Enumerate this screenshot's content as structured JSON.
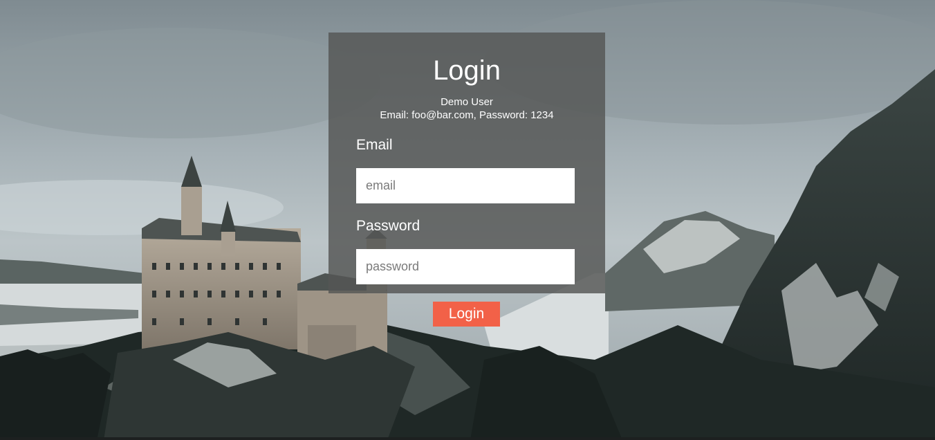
{
  "login": {
    "title": "Login",
    "demo_heading": "Demo User",
    "demo_credentials": "Email: foo@bar.com, Password: 1234",
    "email_label": "Email",
    "email_placeholder": "email",
    "email_value": "",
    "password_label": "Password",
    "password_placeholder": "password",
    "password_value": "",
    "submit_label": "Login"
  },
  "colors": {
    "button": "#f26148",
    "panel": "#545654",
    "text": "#ffffff"
  }
}
